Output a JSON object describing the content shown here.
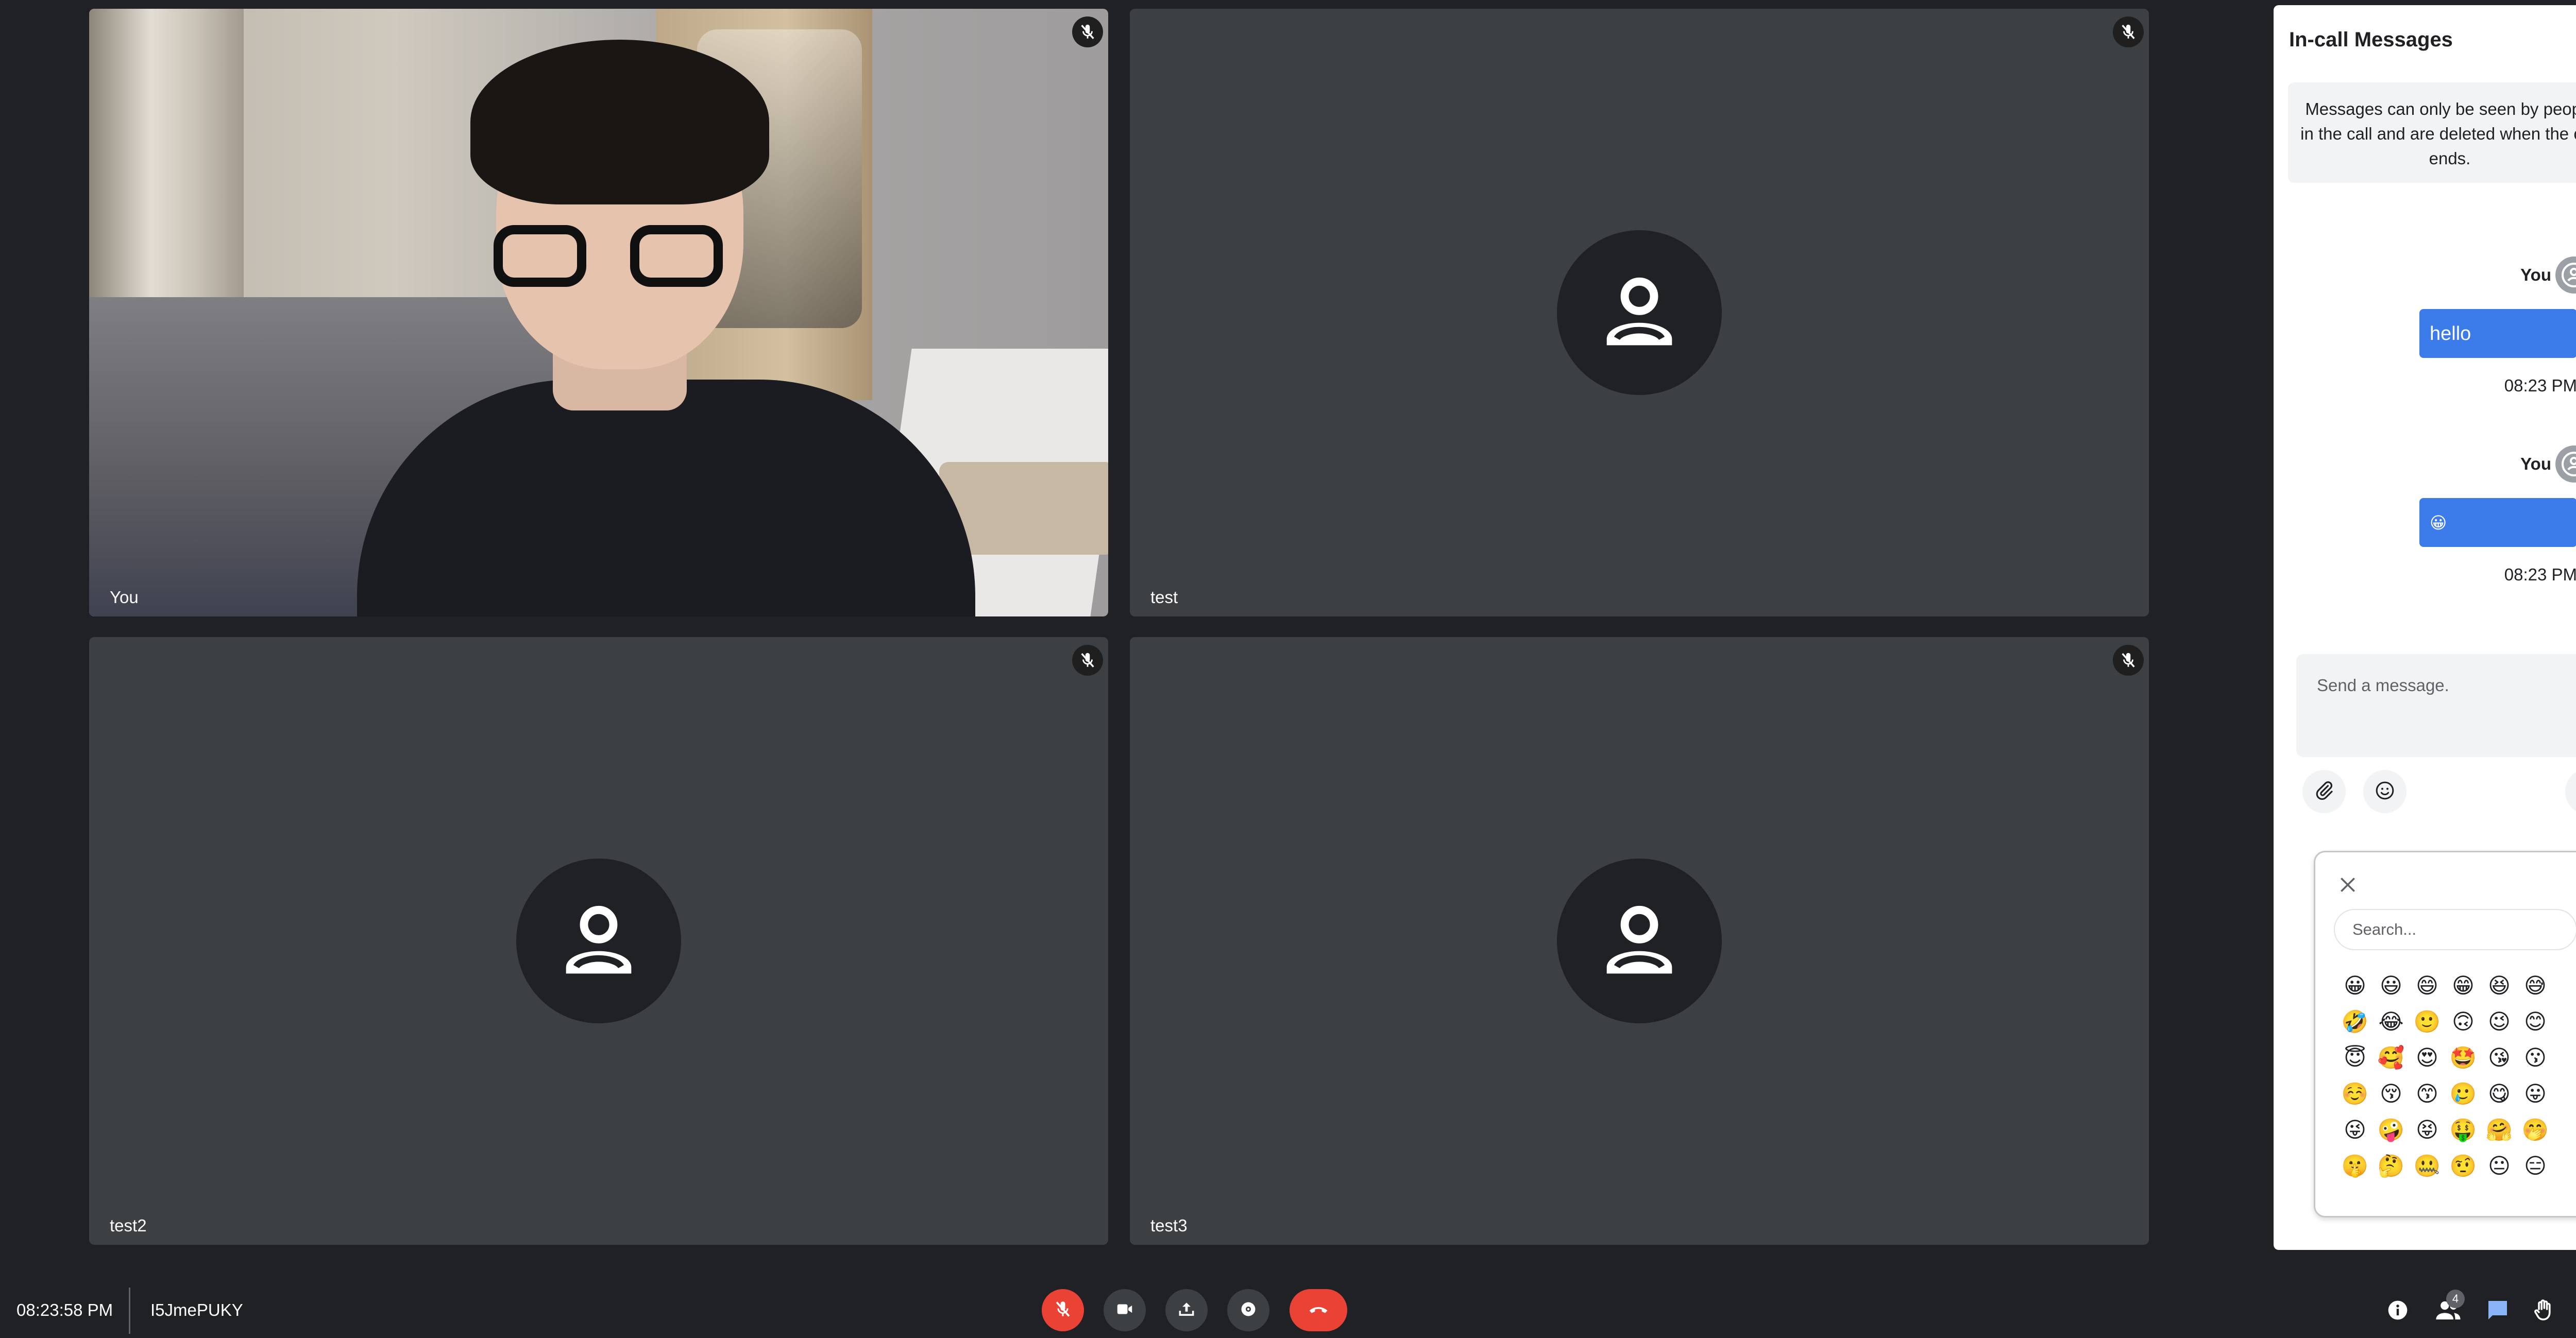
{
  "tiles": [
    {
      "name": "You"
    },
    {
      "name": "test"
    },
    {
      "name": "test2"
    },
    {
      "name": "test3"
    }
  ],
  "chat": {
    "title": "In-call Messages",
    "notice": "Messages can only be seen by people in the call and are deleted when the call ends.",
    "messages": [
      {
        "sender": "You",
        "text": "hello",
        "time": "08:23 PM"
      },
      {
        "sender": "You",
        "text": "😀",
        "time": "08:23 PM"
      }
    ],
    "input_placeholder": "Send a message.",
    "emoji_picker": {
      "search_placeholder": "Search...",
      "emojis": [
        "😀",
        "😃",
        "😄",
        "😁",
        "😆",
        "😅",
        "🤣",
        "😂",
        "🙂",
        "🙃",
        "😉",
        "😊",
        "😇",
        "🥰",
        "😍",
        "🤩",
        "😘",
        "😗",
        "☺️",
        "😚",
        "😙",
        "🥲",
        "😋",
        "😛",
        "😜",
        "🤪",
        "😝",
        "🤑",
        "🤗",
        "🤭",
        "🤫",
        "🤔",
        "🤐",
        "🤨",
        "😐",
        "😑"
      ]
    }
  },
  "bottom_bar": {
    "clock": "08:23:58 PM",
    "meeting_code": "I5JmePUKY",
    "people_count": "4"
  },
  "colors": {
    "background": "#202124",
    "tile": "#3c4043",
    "danger": "#ea4335",
    "bubble": "#3b7bea",
    "chat_active": "#8ab4f8"
  },
  "icons": {
    "mic_off": "mic-off-icon",
    "avatar": "person-icon",
    "camera": "videocam-icon",
    "present": "present-screen-icon",
    "more": "more-options-icon",
    "leave": "call-end-icon",
    "info": "info-icon",
    "people": "people-icon",
    "chat": "chat-icon",
    "raise_hand": "raise-hand-icon",
    "attach": "paperclip-icon",
    "emoji": "smiley-icon",
    "send": "send-icon",
    "close": "close-icon"
  }
}
